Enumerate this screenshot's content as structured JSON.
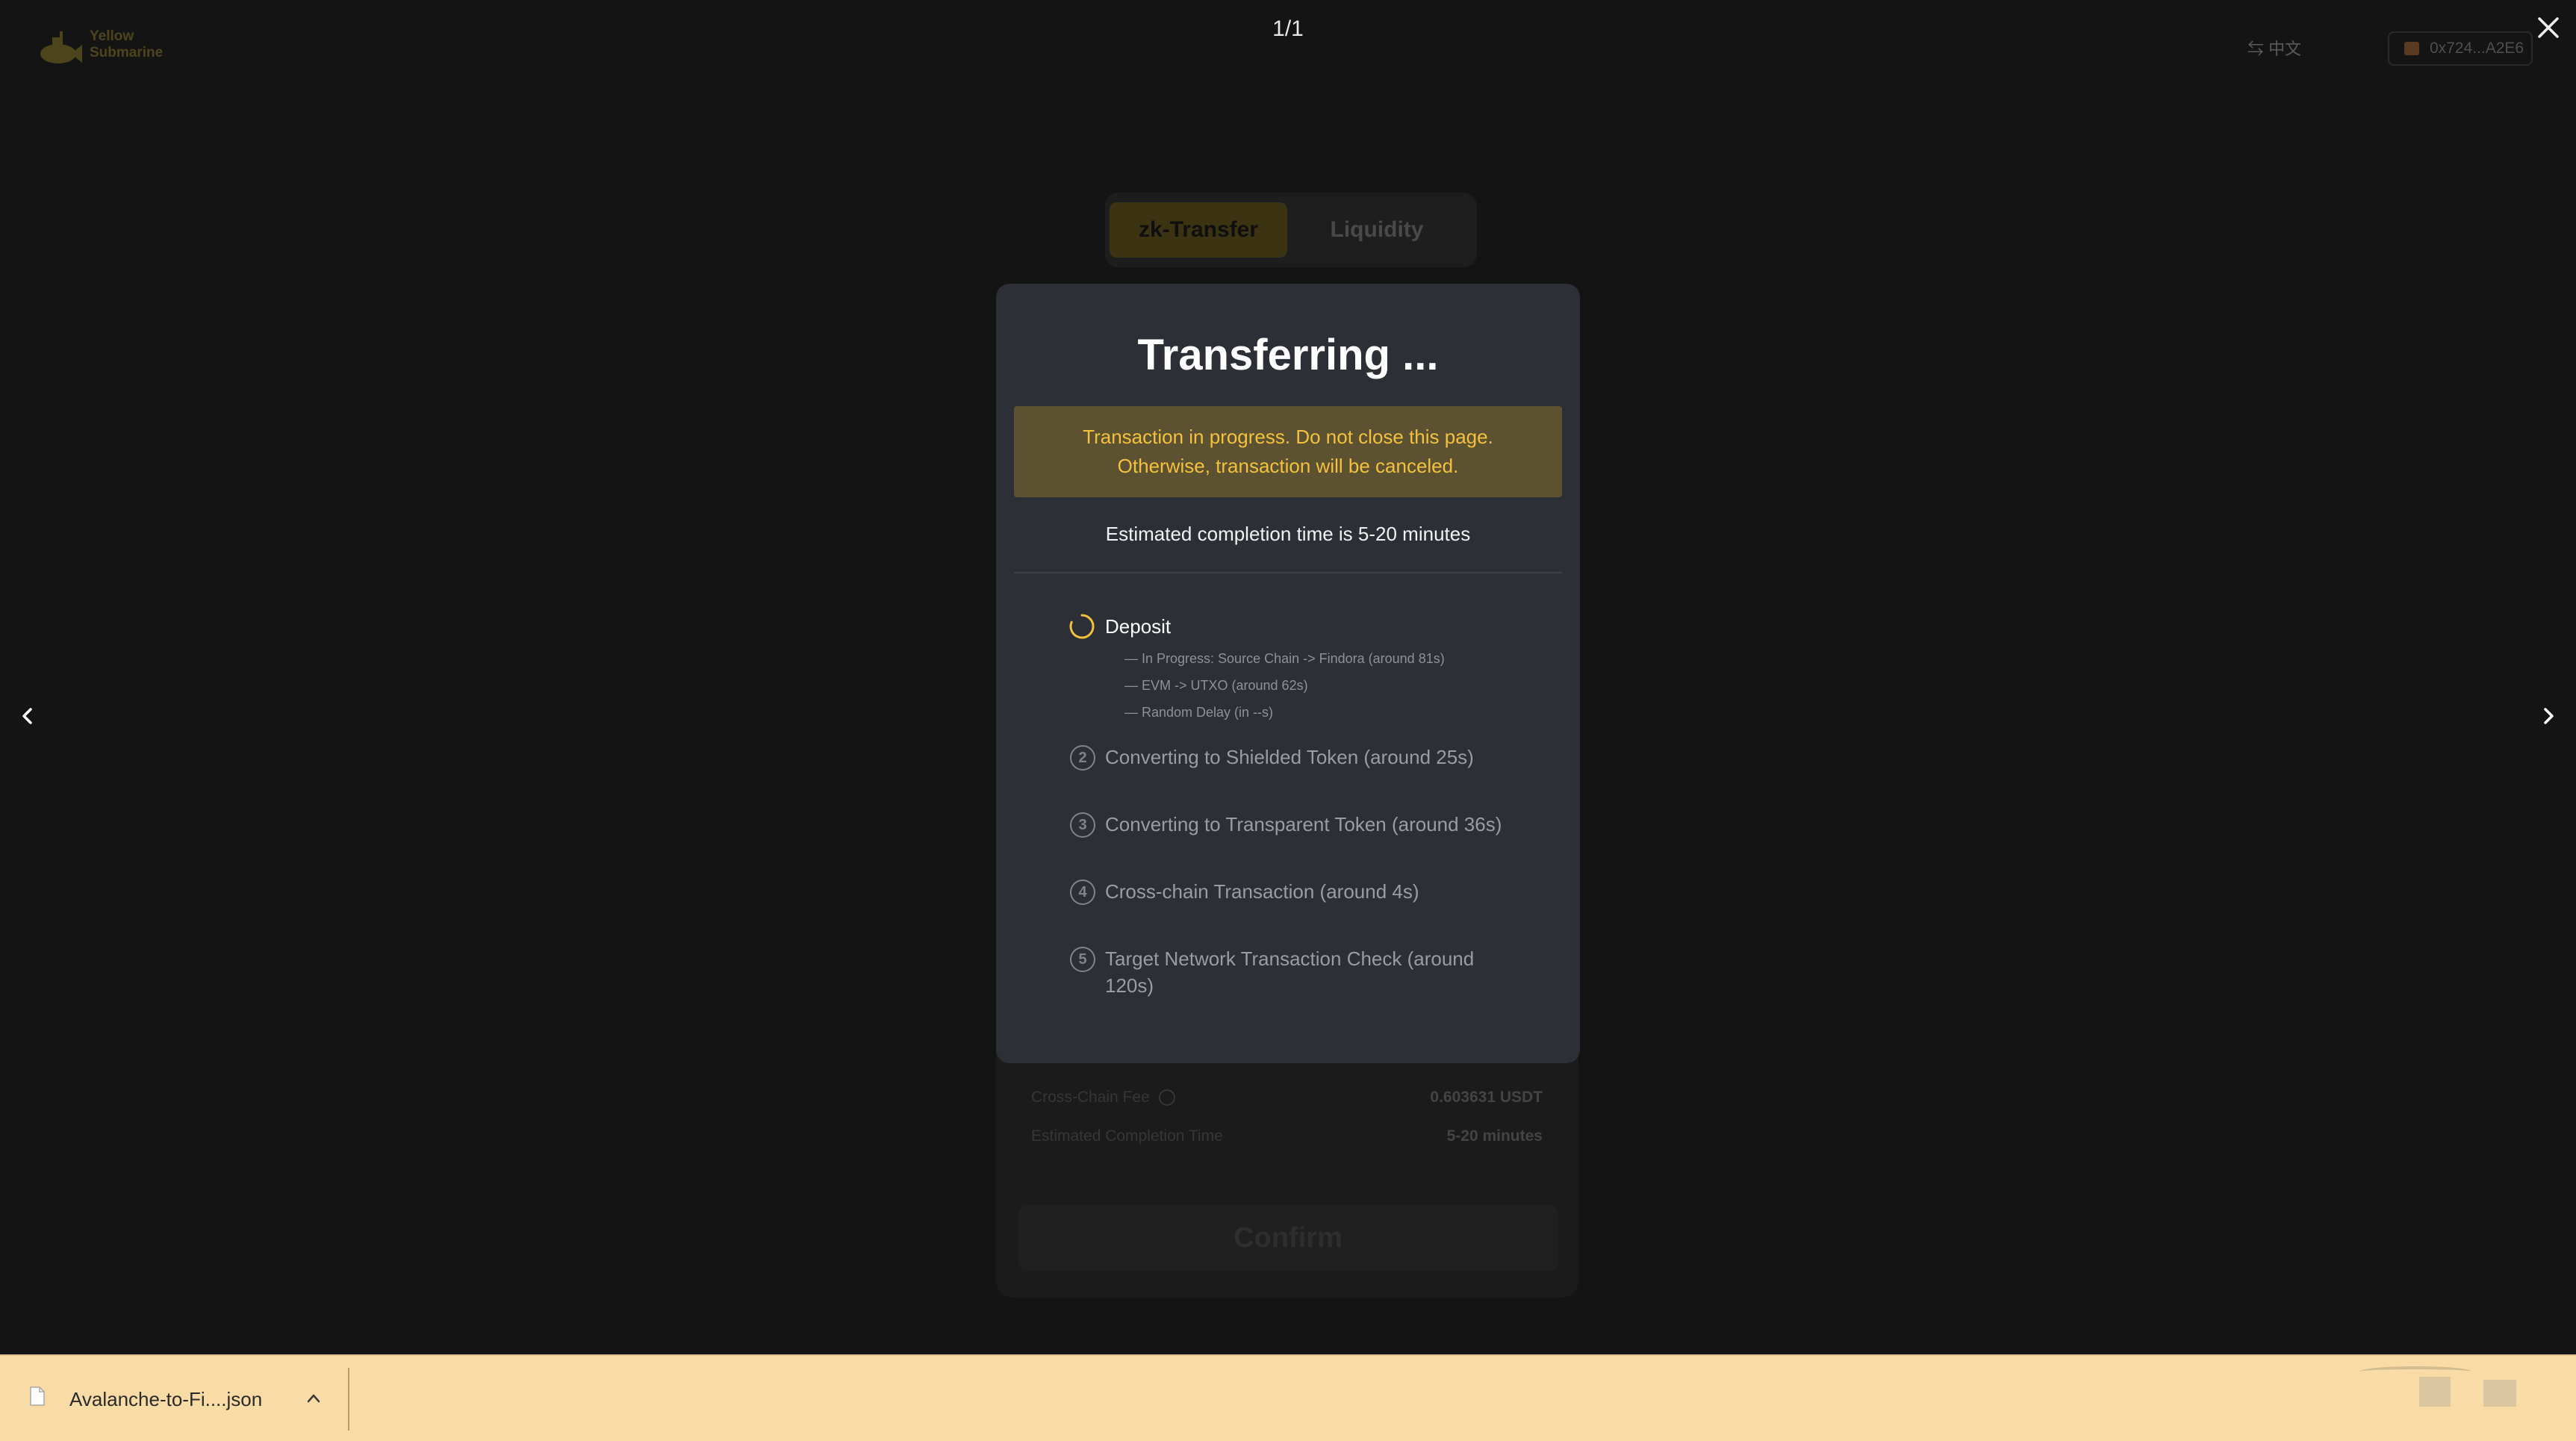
{
  "viewer": {
    "page_counter": "1/1"
  },
  "app": {
    "logo_line1": "Yellow",
    "logo_line2": "Submarine",
    "language": "⇆ 中文",
    "wallet": "0x724...A2E6"
  },
  "tabs": [
    "zk-Transfer",
    "Liquidity"
  ],
  "background_form": {
    "fee_label": "Cross-Chain Fee",
    "fee_value": "0.603631 USDT",
    "time_label": "Estimated Completion Time",
    "time_value": "5-20 minutes",
    "confirm_label": "Confirm"
  },
  "modal": {
    "title": "Transferring ...",
    "warning_line1": "Transaction in progress. Do not close this page.",
    "warning_line2": "Otherwise, transaction will be canceled.",
    "estimate": "Estimated completion time is 5-20 minutes",
    "steps": [
      {
        "label": "Deposit",
        "status": "in-progress",
        "substeps": [
          "— In Progress: Source Chain -> Findora  (around 81s)",
          "— EVM -> UTXO  (around 62s)",
          "— Random Delay (in --s)"
        ]
      },
      {
        "number": "2",
        "label": "Converting to Shielded Token  (around 25s)"
      },
      {
        "number": "3",
        "label": "Converting to Transparent Token  (around 36s)"
      },
      {
        "number": "4",
        "label": "Cross-chain Transaction  (around 4s)"
      },
      {
        "number": "5",
        "label": "Target Network Transaction Check  (around 120s)"
      }
    ]
  },
  "download_bar": {
    "file_name": "Avalanche-to-Fi....json"
  },
  "colors": {
    "accent": "#f4c13c",
    "modal_bg": "#2c2f35",
    "warning_bg": "#5c5232",
    "download_bar_bg": "#f8dba5"
  }
}
